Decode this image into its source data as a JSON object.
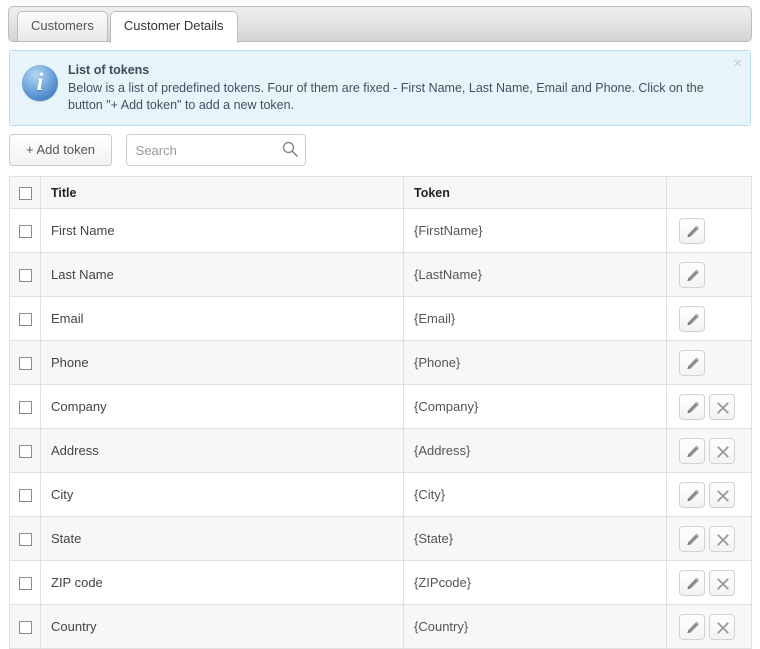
{
  "tabs": [
    {
      "label": "Customers",
      "active": false
    },
    {
      "label": "Customer Details",
      "active": true
    }
  ],
  "info": {
    "title": "List of tokens",
    "body": "Below is a list of predefined tokens. Four of them are fixed - First Name, Last Name, Email and Phone. Click on the button \"+ Add token\" to add a new token.",
    "close_label": "×",
    "icon": "info-circle-icon",
    "background_color": "#e8f4fb",
    "border_color": "#b8dcf0"
  },
  "toolbar": {
    "add_label": "+ Add token",
    "search_placeholder": "Search",
    "search_value": "",
    "search_icon": "search-icon"
  },
  "table": {
    "columns": [
      "",
      "Title",
      "Token",
      ""
    ],
    "rows": [
      {
        "title": "First Name",
        "token": "{FirstName}",
        "can_edit": true,
        "can_delete": false
      },
      {
        "title": "Last Name",
        "token": "{LastName}",
        "can_edit": true,
        "can_delete": false
      },
      {
        "title": "Email",
        "token": "{Email}",
        "can_edit": true,
        "can_delete": false
      },
      {
        "title": "Phone",
        "token": "{Phone}",
        "can_edit": true,
        "can_delete": false
      },
      {
        "title": "Company",
        "token": "{Company}",
        "can_edit": true,
        "can_delete": true
      },
      {
        "title": "Address",
        "token": "{Address}",
        "can_edit": true,
        "can_delete": true
      },
      {
        "title": "City",
        "token": "{City}",
        "can_edit": true,
        "can_delete": true
      },
      {
        "title": "State",
        "token": "{State}",
        "can_edit": true,
        "can_delete": true
      },
      {
        "title": "ZIP code",
        "token": "{ZIPcode}",
        "can_edit": true,
        "can_delete": true
      },
      {
        "title": "Country",
        "token": "{Country}",
        "can_edit": true,
        "can_delete": true
      }
    ],
    "edit_icon": "pencil-icon",
    "delete_icon": "close-x-icon",
    "select_all_checkbox": false
  }
}
